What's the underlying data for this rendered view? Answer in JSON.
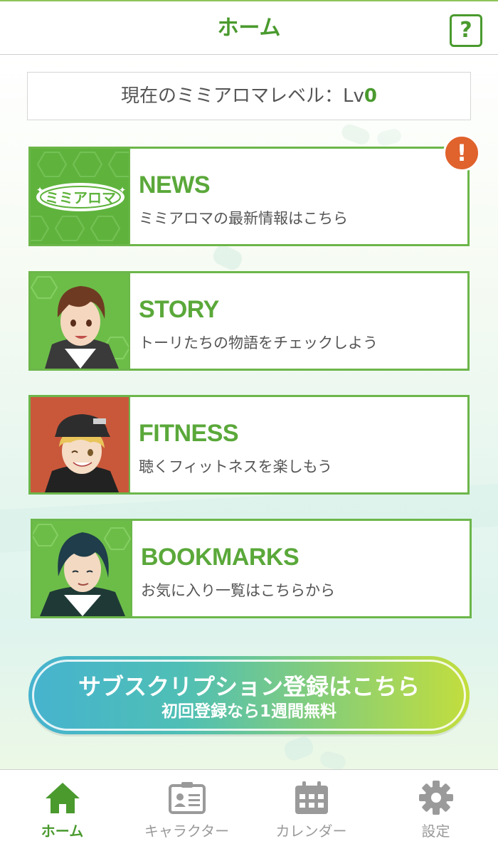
{
  "header": {
    "title": "ホーム",
    "help_label": "?"
  },
  "level": {
    "label": "現在のミミアロマレベル：Lv",
    "value": "0"
  },
  "menu": [
    {
      "title": "NEWS",
      "subtitle": "ミミアロマの最新情報はこちら",
      "thumb": "mimiaroma-logo",
      "badge": "!"
    },
    {
      "title": "STORY",
      "subtitle": "トーリたちの物語をチェックしよう",
      "thumb": "character-brown-hair"
    },
    {
      "title": "FITNESS",
      "subtitle": "聴くフィットネスを楽しもう",
      "thumb": "character-blonde-cap"
    },
    {
      "title": "BOOKMARKS",
      "subtitle": "お気に入り一覧はこちらから",
      "thumb": "character-dark-hair"
    }
  ],
  "subscription": {
    "main": "サブスクリプション登録はこちら",
    "sub": "初回登録なら1週間無料"
  },
  "tabs": [
    {
      "label": "ホーム",
      "icon": "home-icon",
      "active": true
    },
    {
      "label": "キャラクター",
      "icon": "id-card-icon",
      "active": false
    },
    {
      "label": "カレンダー",
      "icon": "calendar-icon",
      "active": false
    },
    {
      "label": "設定",
      "icon": "gear-icon",
      "active": false
    }
  ],
  "colors": {
    "accent_green": "#4a9a2e",
    "card_border": "#6cb64a",
    "alert_orange": "#e0622c",
    "inactive_gray": "#9a9a9a"
  }
}
